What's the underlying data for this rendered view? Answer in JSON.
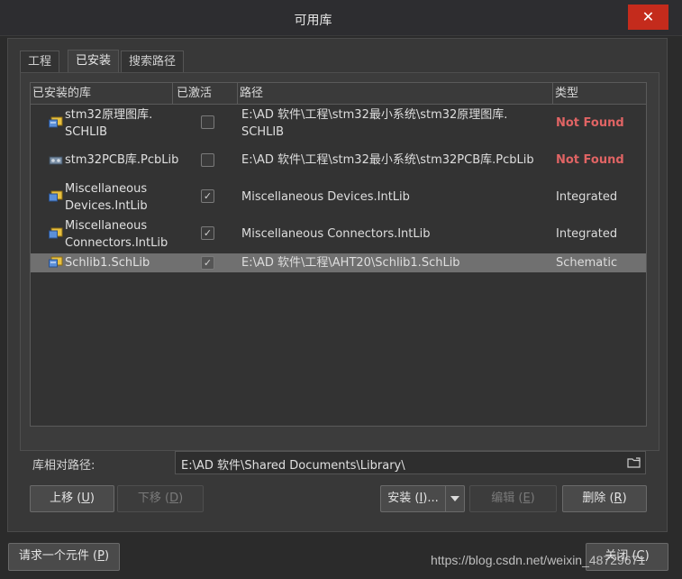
{
  "window": {
    "title": "可用库",
    "close_glyph": "✕"
  },
  "tabs": [
    {
      "label": "工程",
      "active": false
    },
    {
      "label": "已安装",
      "active": true
    },
    {
      "label": "搜索路径",
      "active": false
    }
  ],
  "table": {
    "columns": [
      "已安装的库",
      "已激活",
      "路径",
      "类型"
    ],
    "rows": [
      {
        "name_line1": "stm32原理图库.",
        "name_line2": "SCHLIB",
        "icon": "schematic-library-icon",
        "active": false,
        "path_line1": "E:\\AD 软件\\工程\\stm32最小系统\\stm32原理图库.",
        "path_line2": "SCHLIB",
        "type": "Not Found",
        "selected": false
      },
      {
        "name_line1": "stm32PCB库.PcbLib",
        "name_line2": "",
        "icon": "pcb-library-icon",
        "active": false,
        "path_line1": "E:\\AD 软件\\工程\\stm32最小系统\\stm32PCB库.PcbLib",
        "path_line2": "",
        "type": "Not Found",
        "selected": false
      },
      {
        "name_line1": "Miscellaneous",
        "name_line2": "Devices.IntLib",
        "icon": "integrated-library-icon",
        "active": true,
        "path_line1": "Miscellaneous Devices.IntLib",
        "path_line2": "",
        "type": "Integrated",
        "selected": false
      },
      {
        "name_line1": "Miscellaneous",
        "name_line2": "Connectors.IntLib",
        "icon": "integrated-library-icon",
        "active": true,
        "path_line1": "Miscellaneous Connectors.IntLib",
        "path_line2": "",
        "type": "Integrated",
        "selected": false
      },
      {
        "name_line1": "Schlib1.SchLib",
        "name_line2": "",
        "icon": "schematic-library-icon",
        "active": true,
        "path_line1": "E:\\AD 软件\\工程\\AHT20\\Schlib1.SchLib",
        "path_line2": "",
        "type": "Schematic",
        "selected": true
      }
    ]
  },
  "relative_path": {
    "label": "库相对路径:",
    "value": "E:\\AD 软件\\Shared Documents\\Library\\"
  },
  "buttons": {
    "move_up": "上移 (",
    "move_up_key": "U",
    "move_down": "下移 (",
    "move_down_key": "D",
    "install": "安装 (",
    "install_key": "I",
    "install_suffix": ")...",
    "edit": "编辑 (",
    "edit_key": "E",
    "remove": "删除 (",
    "remove_key": "R",
    "request": "请求一个元件 (",
    "request_key": "P",
    "close": "关闭 (",
    "close_key": "C",
    "paren_close": ")"
  },
  "watermark": "https://blog.csdn.net/weixin_48729671",
  "colors": {
    "not_found": "#e06464",
    "selected_row": "#707070",
    "close_button": "#c42b1c"
  }
}
